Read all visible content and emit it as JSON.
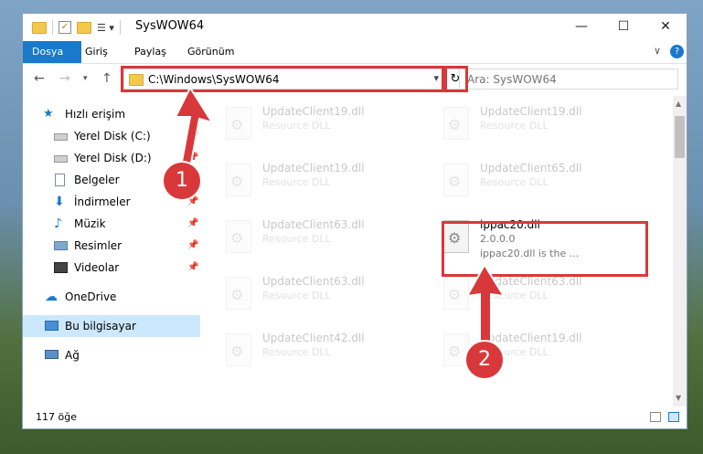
{
  "window": {
    "title": "SysWOW64"
  },
  "ribbon": {
    "tabs": [
      "Dosya",
      "Giriş",
      "Paylaş",
      "Görünüm"
    ]
  },
  "address": {
    "path": "C:\\Windows\\SysWOW64",
    "search_placeholder": "Ara: SysWOW64"
  },
  "sidebar": {
    "quick_access": "Hızlı erişim",
    "items": [
      {
        "label": "Yerel Disk (C:)",
        "icon": "drive-icon",
        "pinned": true
      },
      {
        "label": "Yerel Disk (D:)",
        "icon": "drive-icon",
        "pinned": true
      },
      {
        "label": "Belgeler",
        "icon": "documents-icon",
        "pinned": true
      },
      {
        "label": "İndirmeler",
        "icon": "downloads-icon",
        "pinned": true
      },
      {
        "label": "Müzik",
        "icon": "music-icon",
        "pinned": true
      },
      {
        "label": "Resimler",
        "icon": "pictures-icon",
        "pinned": true
      },
      {
        "label": "Videolar",
        "icon": "videos-icon",
        "pinned": true
      }
    ],
    "onedrive": "OneDrive",
    "this_pc": "Bu bilgisayar",
    "network": "Ağ"
  },
  "files": [
    {
      "name": "UpdateClient19.dll",
      "type": "Resource DLL"
    },
    {
      "name": "UpdateClient19.dll",
      "type": "Resource DLL"
    },
    {
      "name": "UpdateClient19.dll",
      "type": "Resource DLL"
    },
    {
      "name": "UpdateClient65.dll",
      "type": "Resource DLL"
    },
    {
      "name": "UpdateClient63.dll",
      "type": "Resource DLL"
    },
    {
      "name": "UpdateClient63.dll",
      "type": "Resource DLL"
    },
    {
      "name": "UpdateClient42.dll",
      "type": "Resource DLL"
    },
    {
      "name": "UpdateClient19.dll",
      "type": "Resource DLL"
    }
  ],
  "highlighted_file": {
    "name": "ippac20.dll",
    "version": "2.0.0.0",
    "description": "ippac20.dll is the ..."
  },
  "status": {
    "count": "117 öğe"
  },
  "annotations": [
    "1",
    "2"
  ],
  "colors": {
    "accent": "#1979ca",
    "highlight": "#d9383a",
    "selection": "#cce8ff"
  }
}
